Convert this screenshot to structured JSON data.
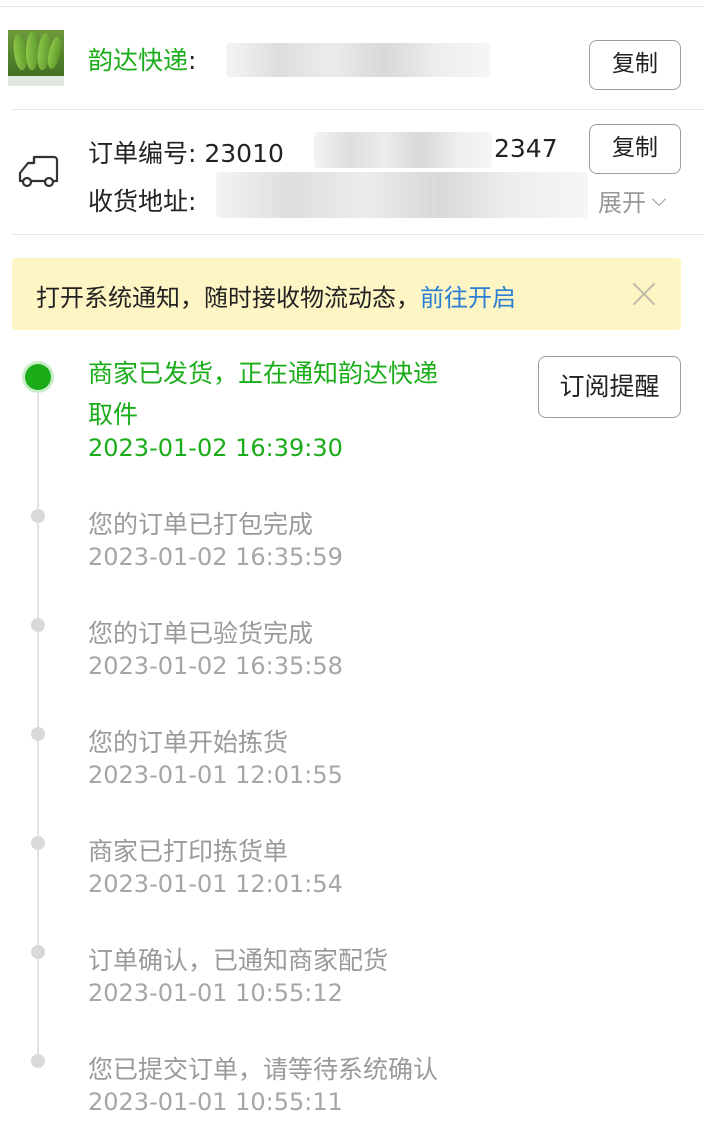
{
  "courier": {
    "name": "韵达快递",
    "colon": ":",
    "copy_label": "复制"
  },
  "order": {
    "number_label": "订单编号: ",
    "number_prefix": "23010",
    "number_suffix": "2347",
    "copy_label": "复制",
    "address_label": "收货地址:",
    "expand_label": "展开"
  },
  "banner": {
    "text": "打开系统通知，随时接收物流动态，",
    "link": "前往开启"
  },
  "subscribe_label": "订阅提醒",
  "events": [
    {
      "title_line1": "商家已发货，正在通知韵达快递",
      "title_line2": "取件",
      "time": "2023-01-02 16:39:30"
    },
    {
      "title": "您的订单已打包完成",
      "time": "2023-01-02 16:35:59"
    },
    {
      "title": "您的订单已验货完成",
      "time": "2023-01-02 16:35:58"
    },
    {
      "title": "您的订单开始拣货",
      "time": "2023-01-01 12:01:55"
    },
    {
      "title": "商家已打印拣货单",
      "time": "2023-01-01 12:01:54"
    },
    {
      "title": "订单确认，已通知商家配货",
      "time": "2023-01-01 10:55:12"
    },
    {
      "title": "您已提交订单，请等待系统确认",
      "time": "2023-01-01 10:55:11"
    }
  ],
  "colors": {
    "accent_green": "#1aad19",
    "link_blue": "#2a7fd4",
    "banner_bg": "#fdf5c4"
  }
}
